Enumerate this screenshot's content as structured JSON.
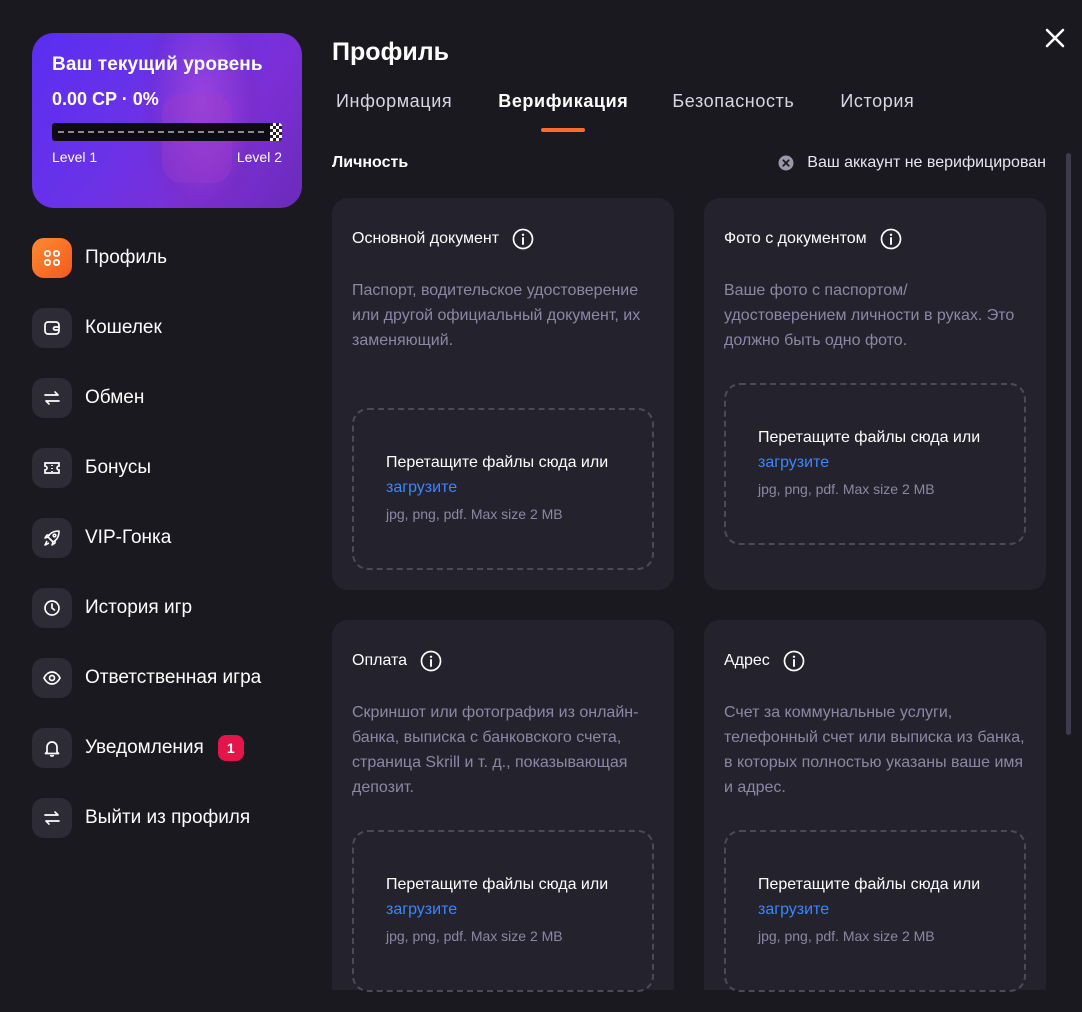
{
  "level": {
    "title": "Ваш текущий уровень",
    "cp": "0.00 CP · 0%",
    "progress_percent": 0,
    "from": "Level 1",
    "to": "Level 2"
  },
  "nav": [
    {
      "label": "Профиль",
      "icon": "grid-icon",
      "active": true
    },
    {
      "label": "Кошелек",
      "icon": "wallet-icon"
    },
    {
      "label": "Обмен",
      "icon": "exchange-icon"
    },
    {
      "label": "Бонусы",
      "icon": "ticket-icon"
    },
    {
      "label": "VIP-Гонка",
      "icon": "rocket-icon"
    },
    {
      "label": "История игр",
      "icon": "clock-icon"
    },
    {
      "label": "Ответственная игра",
      "icon": "eye-icon"
    },
    {
      "label": "Уведомления",
      "icon": "bell-icon",
      "badge": "1"
    },
    {
      "label": "Выйти из профиля",
      "icon": "logout-icon"
    }
  ],
  "page": {
    "title": "Профиль",
    "tabs": [
      "Информация",
      "Верификация",
      "Безопасность",
      "История"
    ],
    "active_tab": "Верификация"
  },
  "section": {
    "title": "Личность",
    "status": "Ваш аккаунт не верифицирован"
  },
  "cards": [
    {
      "title": "Основной документ",
      "description": "Паспорт, водительское удостоверение или другой официальный документ, их заменяющий."
    },
    {
      "title": "Фото с документом",
      "description": "Ваше фото с паспортом/ удостоверением личности в руках. Это должно быть одно фото."
    },
    {
      "title": "Оплата",
      "description": "Скриншот или фотография из онлайн-банка, выписка с банковского счета, страница Skrill и т. д., показывающая депозит."
    },
    {
      "title": "Адрес",
      "description": "Счет за коммунальные услуги, телефонный счет или выписка из банка, в которых полностью указаны ваше имя и адрес."
    }
  ],
  "upload": {
    "text": "Перетащите файлы сюда или",
    "link": "загрузите",
    "hint": "jpg, png, pdf. Max size 2 MB"
  },
  "colors": {
    "background": "#1a1920",
    "card": "#24232d",
    "accent_orange": "#ff6b2c",
    "link_blue": "#3a86ff",
    "badge_red": "#e4154b",
    "level_card": "#5a2ef0"
  }
}
